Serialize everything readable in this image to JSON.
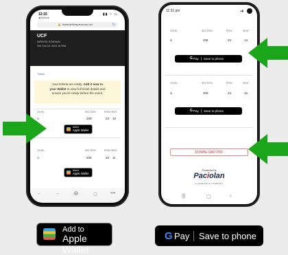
{
  "iphone": {
    "status": {
      "time": "12:15",
      "back_label": "◀ Outlook"
    },
    "url": "ticketdelivery.evenue.net",
    "event": {
      "title": "UCF",
      "venue": "INFINITE STADIUM",
      "date": "Sat, Oct 16, 2021 at TBA"
    },
    "tickets_label": "Tickets",
    "notice_line1": "Your tickets are ready.",
    "notice_bold1": "Add it now to",
    "notice_bold2": "your Wallet",
    "notice_line2": "to view full ticket details and",
    "notice_line3": "ensure you're ready before the event.",
    "table_headers": {
      "level": "LEVEL",
      "section": "SECTION",
      "row_seat": "ROW SEAT"
    },
    "tickets": [
      {
        "level": "U",
        "section": "209",
        "row": "23",
        "seat": "10"
      },
      {
        "level": "U",
        "section": "209",
        "row": "23",
        "seat": "11"
      }
    ],
    "wallet_small_l1": "Add to",
    "wallet_small_l2": "Apple Wallet"
  },
  "android": {
    "status": {
      "time": "11:31 pm"
    },
    "table_headers": {
      "level": "LEVEL",
      "section": "SECTION",
      "row": "ROW",
      "seat": "SEAT"
    },
    "tickets": [
      {
        "level": "U",
        "section": "209",
        "row": "23",
        "seat": "14"
      },
      {
        "level": "U",
        "section": "209",
        "row": "23",
        "seat": "15"
      }
    ],
    "gpay_small": "Save to phone",
    "download": "DOWNLOAD PDF",
    "powered_by": "Powered by",
    "brand_pre": "Pac",
    "brand_i": "i",
    "brand_post": "olan",
    "brand_sub": "A LEARFIELD COMPANY"
  },
  "large_apple_wallet": {
    "line1": "Add to",
    "line2": "Apple Wallet"
  },
  "large_gpay": {
    "g": "G",
    "pay": "Pay",
    "label": "Save to phone"
  },
  "colors": {
    "arrow": "#1aa51a",
    "background": "#ececec"
  }
}
